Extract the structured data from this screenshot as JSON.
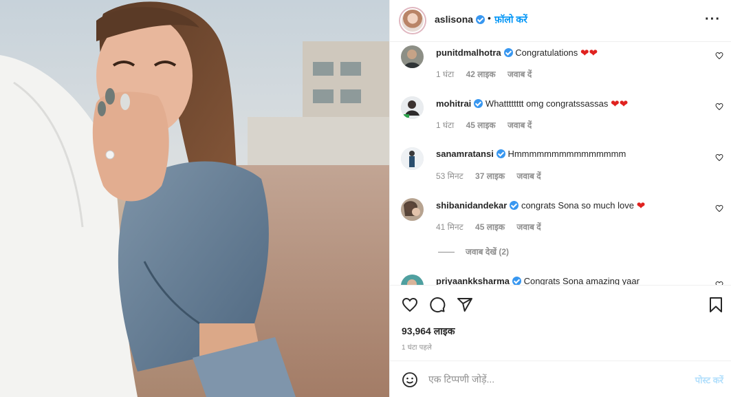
{
  "post": {
    "username": "aslisona",
    "separator": "•",
    "follow_label": "फ़ॉलो करें",
    "more_icon": "more-horizontal-icon",
    "likes_text": "93,964 लाइक",
    "time_text": "1 घंटा पहले"
  },
  "comments": [
    {
      "username": "punitdmalhotra",
      "text": "Congratulations",
      "hearts": "❤❤",
      "time": "1 घंटा",
      "likes": "42 लाइक",
      "reply": "जवाब दें"
    },
    {
      "username": "mohitrai",
      "text": "Whatttttttt omg congratssassas",
      "hearts": "❤❤",
      "time": "1 घंटा",
      "likes": "45 लाइक",
      "reply": "जवाब दें"
    },
    {
      "username": "sanamratansi",
      "text": "Hmmmmmmmmmmmmmmm",
      "hearts": "",
      "time": "53 मिनट",
      "likes": "37 लाइक",
      "reply": "जवाब दें"
    },
    {
      "username": "shibanidandekar",
      "text": "congrats Sona so much love",
      "hearts": "❤",
      "time": "41 मिनट",
      "likes": "45 लाइक",
      "reply": "जवाब दें"
    },
    {
      "username": "priyaankksharma",
      "text": "Congrats Sona amazing yaar",
      "hearts": "",
      "time": "",
      "likes": "",
      "reply": ""
    }
  ],
  "replies_label": "जवाब देखें (2)",
  "add_comment": {
    "placeholder": "एक टिप्पणी जोड़ें...",
    "post_label": "पोस्ट करें"
  },
  "colors": {
    "accent": "#0095f6",
    "heart": "#e0221f",
    "muted": "#8e8e8e",
    "verified": "#3897f0"
  }
}
